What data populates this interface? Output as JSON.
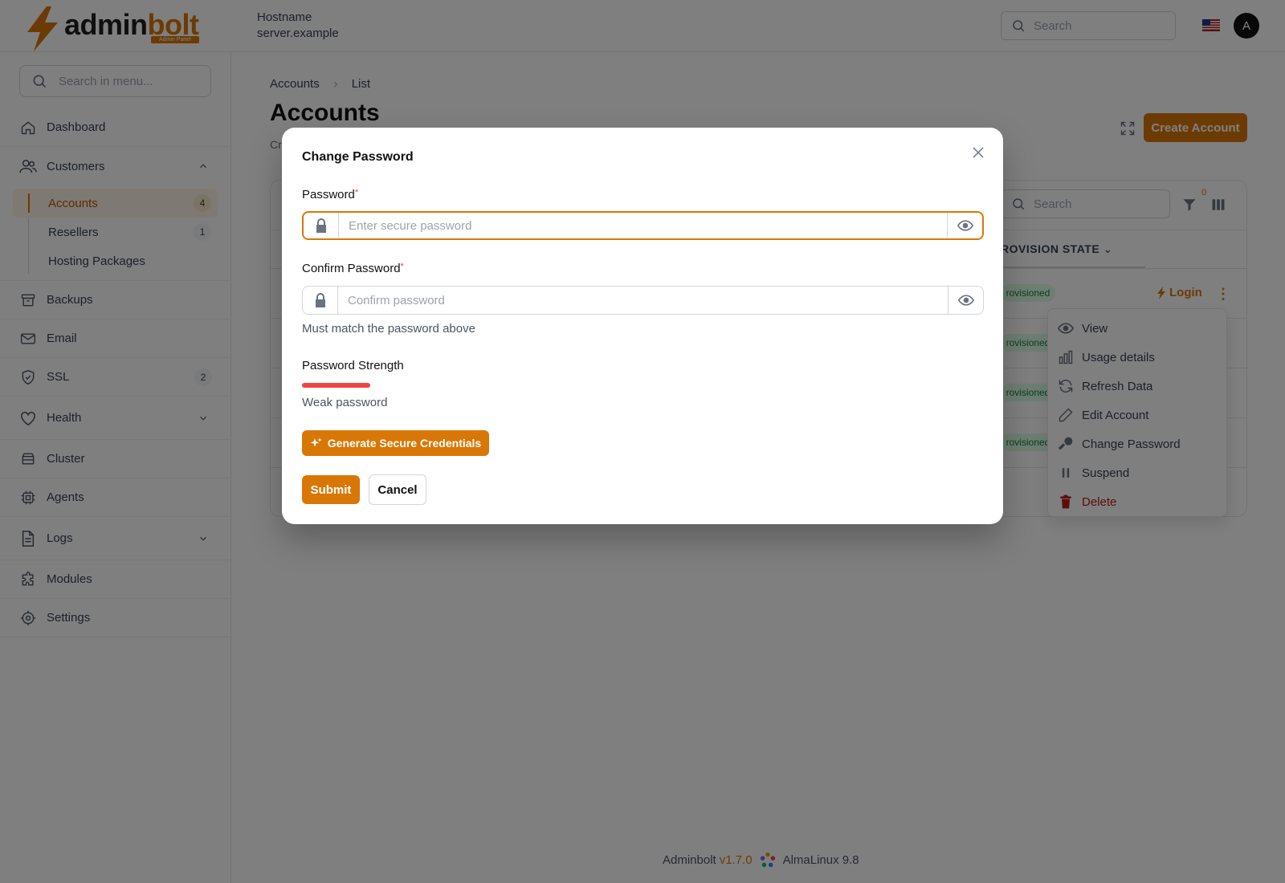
{
  "header": {
    "logo_part1": "admin",
    "logo_part2": "bolt",
    "logo_badge": "Admin Panel",
    "hostname_label": "Hostname",
    "hostname_value": "server.example",
    "search_placeholder": "Search",
    "avatar_initial": "A"
  },
  "sidebar": {
    "search_placeholder": "Search in menu...",
    "items": {
      "dashboard": "Dashboard",
      "customers": "Customers",
      "backups": "Backups",
      "email": "Email",
      "ssl": "SSL",
      "ssl_badge": "2",
      "health": "Health",
      "cluster": "Cluster",
      "agents": "Agents",
      "logs": "Logs",
      "modules": "Modules",
      "settings": "Settings"
    },
    "customers_sub": {
      "accounts": "Accounts",
      "accounts_badge": "4",
      "resellers": "Resellers",
      "resellers_badge": "1",
      "hosting_packages": "Hosting Packages"
    }
  },
  "main": {
    "breadcrumb": [
      "Accounts",
      "List"
    ],
    "title": "Accounts",
    "subtitle_visible": "Cr",
    "create_button": "Create Account",
    "table": {
      "search_placeholder": "Search",
      "filter_count": "0",
      "column_provision_state": "ROVISION STATE",
      "row_status": [
        "rovisioned",
        "rovisioned",
        "rovisioned",
        "rovisioned"
      ],
      "login_label": "Login"
    },
    "row_menu": {
      "view": "View",
      "usage": "Usage details",
      "refresh": "Refresh Data",
      "edit": "Edit Account",
      "change_password": "Change Password",
      "suspend": "Suspend",
      "delete": "Delete"
    }
  },
  "footer": {
    "app": "Adminbolt",
    "version": "v1.7.0",
    "os": "AlmaLinux 9.8"
  },
  "modal": {
    "title": "Change Password",
    "password_label": "Password",
    "password_placeholder": "Enter secure password",
    "confirm_label": "Confirm Password",
    "confirm_placeholder": "Confirm password",
    "confirm_hint": "Must match the password above",
    "strength_label": "Password Strength",
    "strength_value": 0.1,
    "strength_text": "Weak password",
    "generate_button": "Generate Secure Credentials",
    "submit_button": "Submit",
    "cancel_button": "Cancel",
    "required_mark": "*"
  },
  "colors": {
    "accent": "#d97706",
    "danger": "#ef4444",
    "success_bg": "#dcfce7",
    "success_text": "#15803d"
  }
}
